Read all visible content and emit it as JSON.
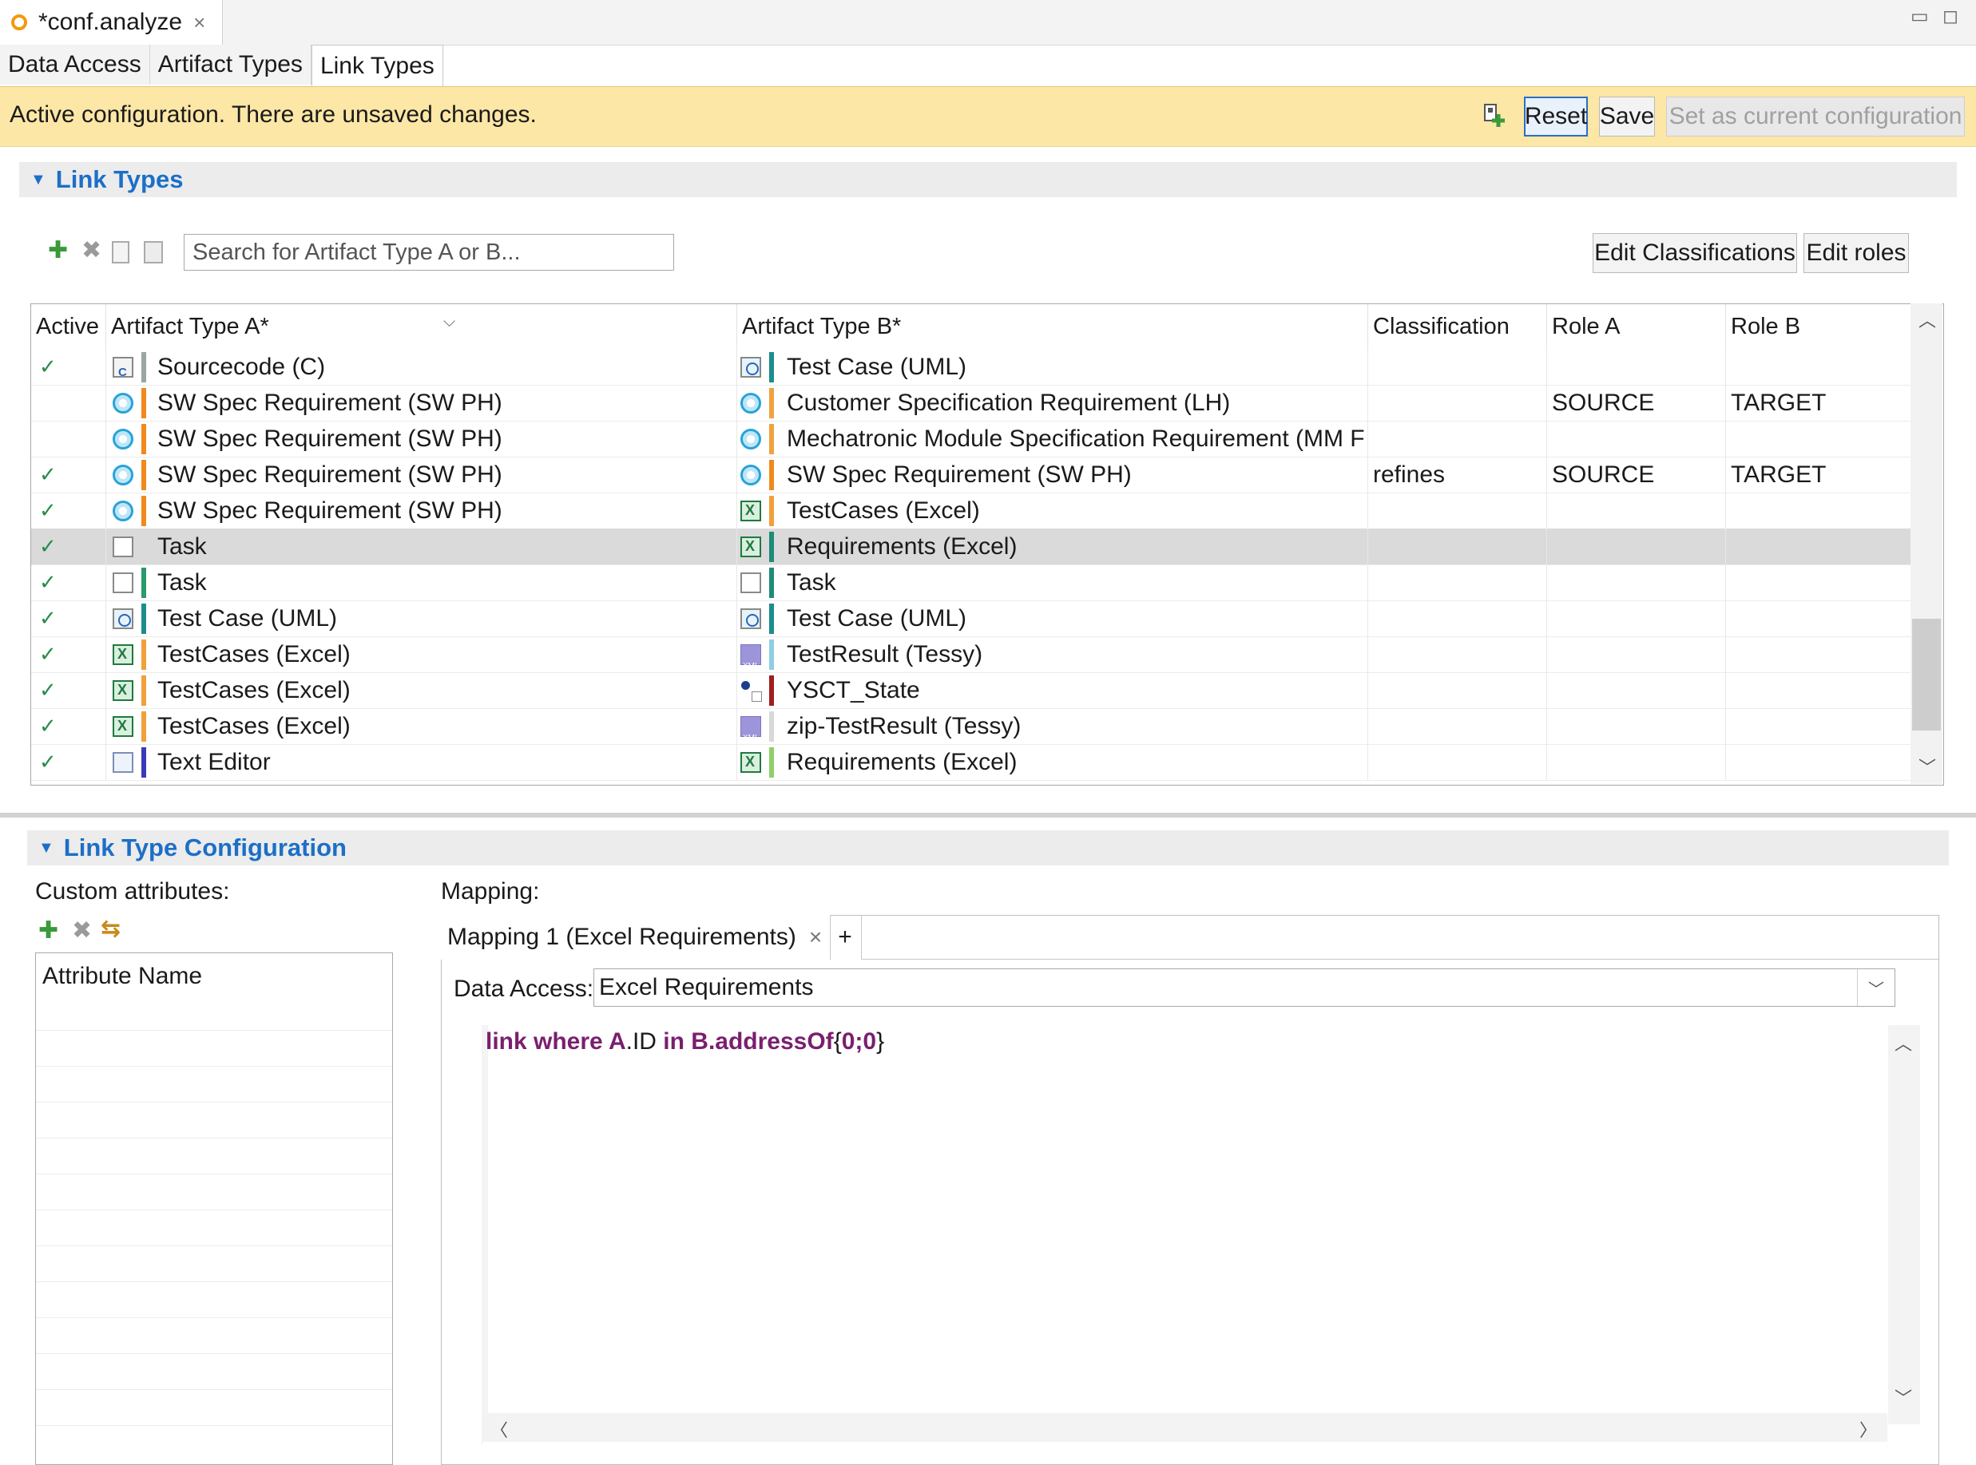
{
  "editor": {
    "tab_title": "*conf.analyze",
    "tab_close": "×",
    "minimize": "▭",
    "maximize": "◻"
  },
  "page_tabs": [
    "Data Access",
    "Artifact Types",
    "Link Types"
  ],
  "status": {
    "message": "Active configuration. There are unsaved changes.",
    "reset_label": "Reset",
    "save_label": "Save",
    "set_current_label": "Set as current configuration"
  },
  "link_types_section": {
    "title": "Link Types",
    "search_placeholder": "Search for Artifact Type A or B...",
    "edit_classifications_label": "Edit Classifications",
    "edit_roles_label": "Edit roles",
    "columns": [
      "Active",
      "Artifact Type A*",
      "Artifact Type B*",
      "Classification",
      "Role A",
      "Role B"
    ],
    "rows": [
      {
        "active": true,
        "a": "Sourcecode (C)",
        "a_icon": "sourcecode-icon",
        "a_color": "#9aa6a6",
        "b": "Test Case (UML)",
        "b_icon": "uml-testcase-icon",
        "b_color": "#1e8c8c",
        "classification": "",
        "role_a": "",
        "role_b": ""
      },
      {
        "active": false,
        "a": "SW Spec Requirement (SW PH)",
        "a_icon": "requirement-icon",
        "a_color": "#f08a1c",
        "b": "Customer Specification Requirement (LH)",
        "b_icon": "requirement-icon",
        "b_color": "#f0a23c",
        "classification": "",
        "role_a": "SOURCE",
        "role_b": "TARGET"
      },
      {
        "active": false,
        "a": "SW Spec Requirement (SW PH)",
        "a_icon": "requirement-icon",
        "a_color": "#f08a1c",
        "b": "Mechatronic Module Specification Requirement (MM F",
        "b_icon": "requirement-icon",
        "b_color": "#f0a23c",
        "classification": "",
        "role_a": "",
        "role_b": ""
      },
      {
        "active": true,
        "a": "SW Spec Requirement (SW PH)",
        "a_icon": "requirement-icon",
        "a_color": "#f08a1c",
        "b": "SW Spec Requirement (SW PH)",
        "b_icon": "requirement-icon",
        "b_color": "#f08a1c",
        "classification": "refines",
        "role_a": "SOURCE",
        "role_b": "TARGET"
      },
      {
        "active": true,
        "a": "SW Spec Requirement (SW PH)",
        "a_icon": "requirement-icon",
        "a_color": "#f08a1c",
        "b": "TestCases (Excel)",
        "b_icon": "excel-icon",
        "b_color": "#f2a03a",
        "classification": "",
        "role_a": "",
        "role_b": ""
      },
      {
        "active": true,
        "a": "Task",
        "a_icon": "task-icon",
        "a_color": "",
        "b": "Requirements (Excel)",
        "b_icon": "excel-icon",
        "b_color": "#1e8c78",
        "classification": "",
        "role_a": "",
        "role_b": "",
        "selected": true
      },
      {
        "active": true,
        "a": "Task",
        "a_icon": "task-icon",
        "a_color": "#2a9a6c",
        "b": "Task",
        "b_icon": "task-icon",
        "b_color": "#1e8c78",
        "classification": "",
        "role_a": "",
        "role_b": ""
      },
      {
        "active": true,
        "a": "Test Case (UML)",
        "a_icon": "uml-testcase-icon",
        "a_color": "#1e8c8c",
        "b": "Test Case (UML)",
        "b_icon": "uml-testcase-icon",
        "b_color": "#1e8c8c",
        "classification": "",
        "role_a": "",
        "role_b": ""
      },
      {
        "active": true,
        "a": "TestCases (Excel)",
        "a_icon": "excel-icon",
        "a_color": "#f2a03a",
        "b": "TestResult (Tessy)",
        "b_icon": "xml-icon",
        "b_color": "#8fcfe3",
        "classification": "",
        "role_a": "",
        "role_b": ""
      },
      {
        "active": true,
        "a": "TestCases (Excel)",
        "a_icon": "excel-icon",
        "a_color": "#f2a03a",
        "b": "YSCT_State",
        "b_icon": "state-icon",
        "b_color": "#a01e1e",
        "classification": "",
        "role_a": "",
        "role_b": ""
      },
      {
        "active": true,
        "a": "TestCases (Excel)",
        "a_icon": "excel-icon",
        "a_color": "#f2a03a",
        "b": "zip-TestResult (Tessy)",
        "b_icon": "xml-icon",
        "b_color": "#d8d8d8",
        "classification": "",
        "role_a": "",
        "role_b": ""
      },
      {
        "active": true,
        "a": "Text Editor",
        "a_icon": "text-editor-icon",
        "a_color": "#3a3ab8",
        "b": "Requirements (Excel)",
        "b_icon": "excel-icon",
        "b_color": "#8fcf6a",
        "classification": "",
        "role_a": "",
        "role_b": ""
      }
    ]
  },
  "config_section": {
    "title": "Link Type Configuration",
    "custom_attributes_label": "Custom attributes:",
    "attribute_header": "Attribute Name",
    "mapping_label": "Mapping:",
    "mapping_tab": "Mapping 1 (Excel Requirements)",
    "mapping_tab_close": "×",
    "add_mapping": "+",
    "data_access_label": "Data Access:",
    "data_access_value": "Excel Requirements",
    "code": {
      "kw1": "link where A",
      "t1": ".ID ",
      "kw2": "in B",
      "kw3": ".addressOf",
      "t2": "{",
      "kw4": "0;0",
      "t3": "}"
    }
  },
  "icons": {
    "add": "plus-icon",
    "delete": "delete-icon",
    "copy": "copy-icon",
    "paste": "paste-icon",
    "swap": "swap-icon",
    "new_config": "new-config-icon",
    "sort": "sort-icon"
  }
}
